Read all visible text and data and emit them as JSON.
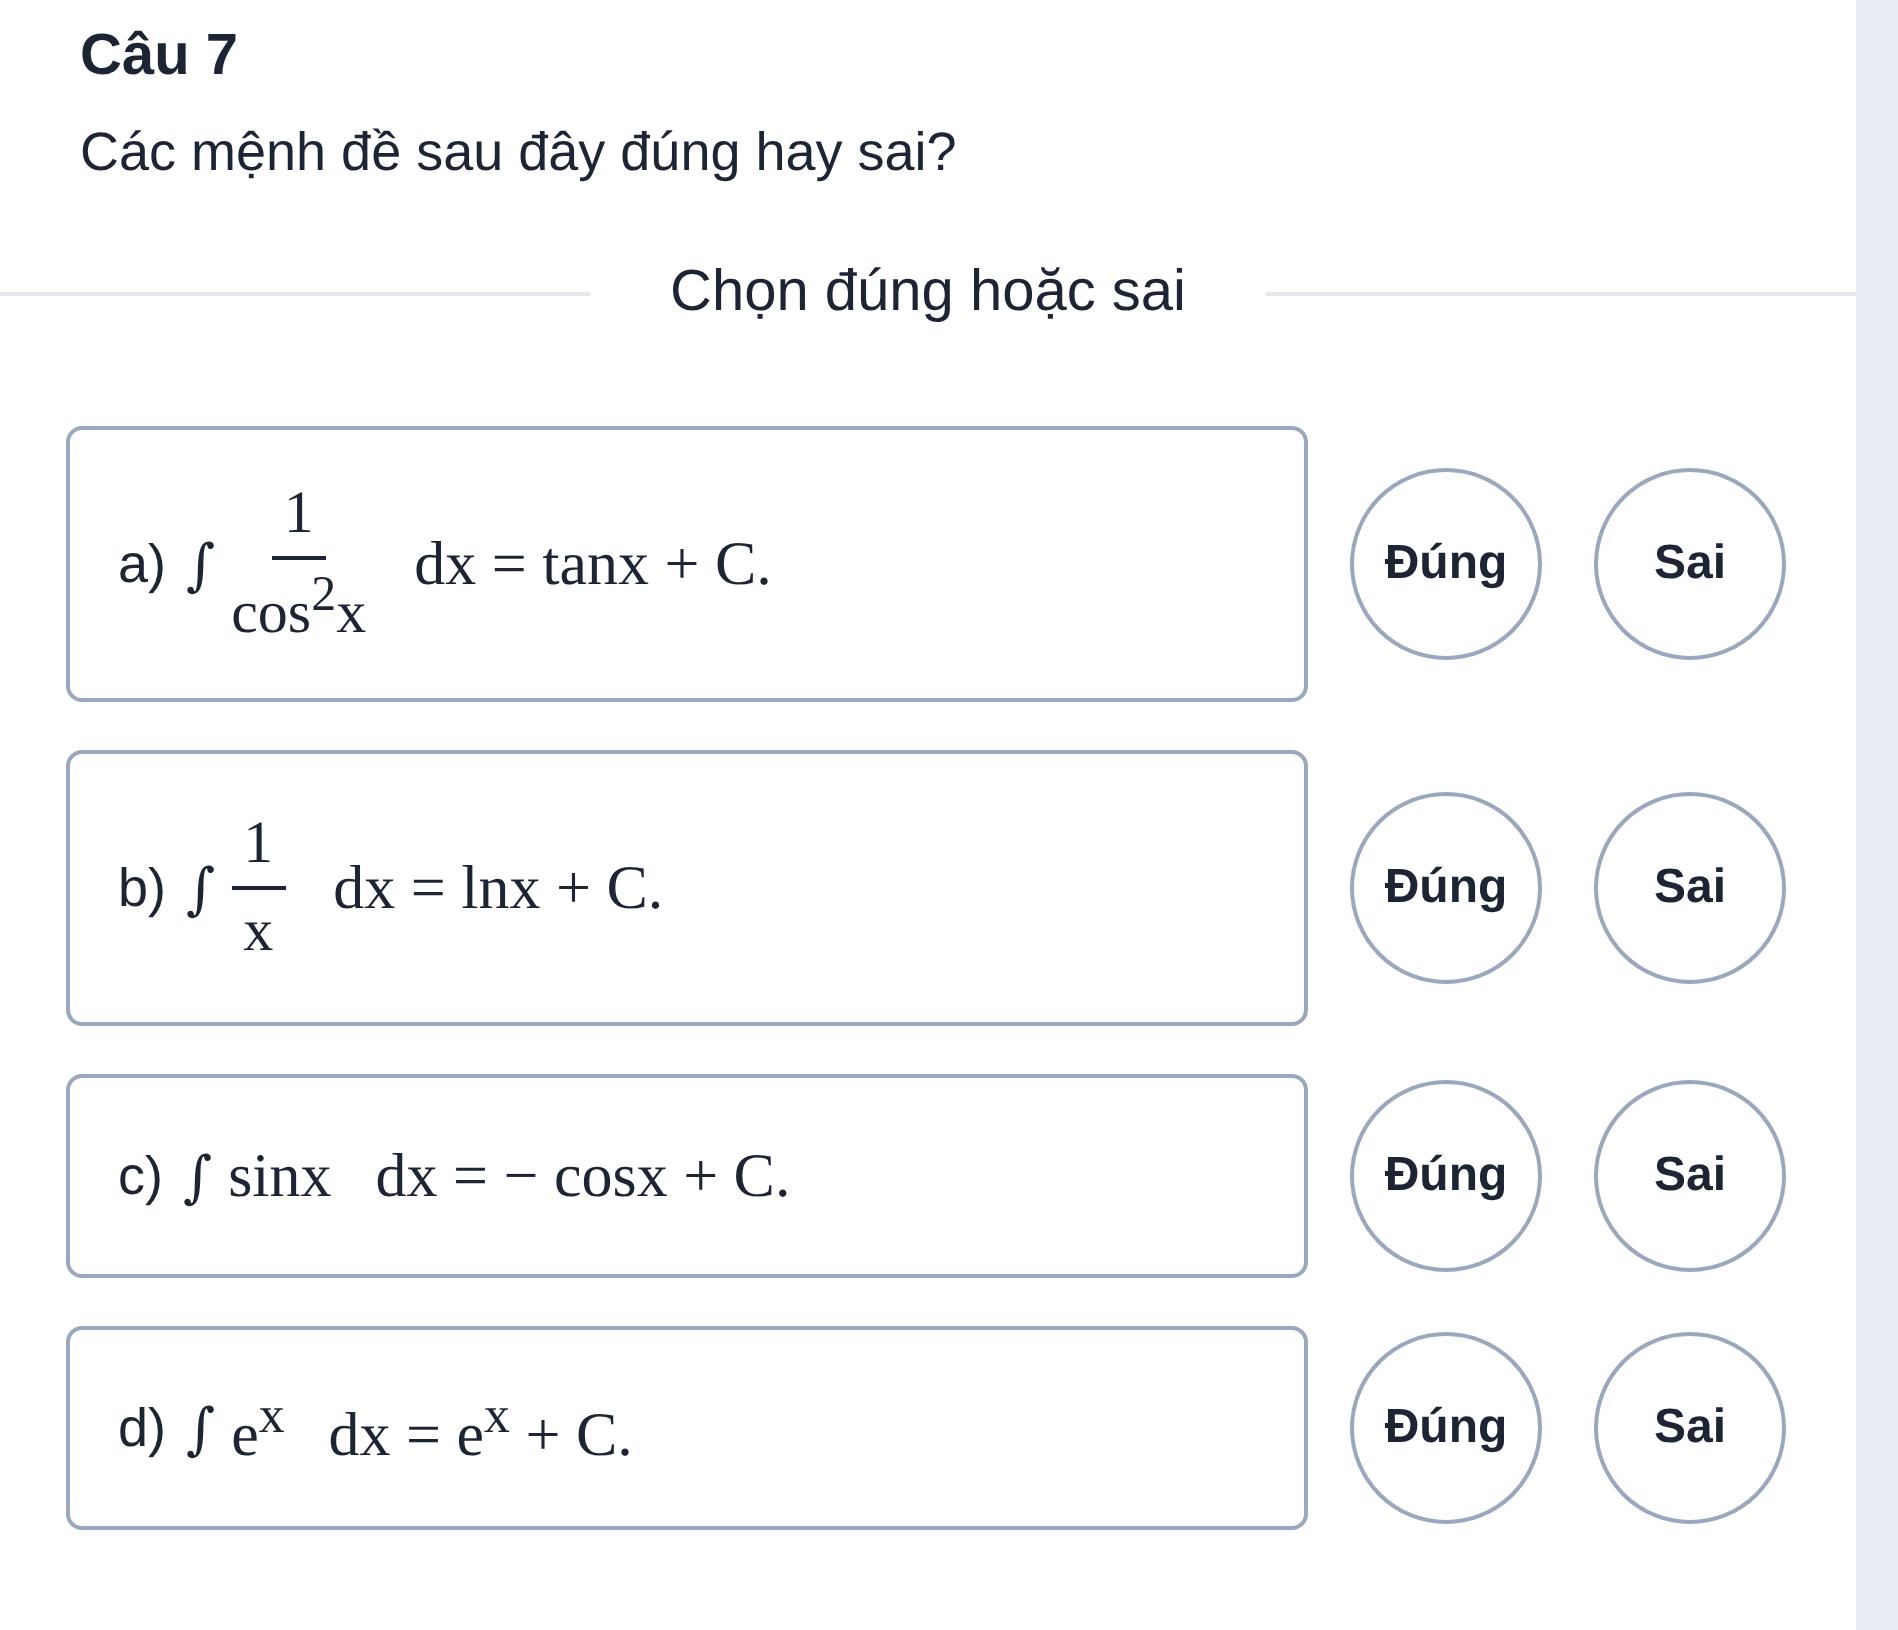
{
  "title": "Câu 7",
  "question": "Các mệnh đề sau đây đúng hay sai?",
  "divider_label": "Chọn đúng hoặc sai",
  "statements": [
    {
      "label": "a)",
      "integral": "∫",
      "kind": "fraction",
      "numerator": "1",
      "denominator": "cos$^{2}$x",
      "rest": "dx = tanx + C.",
      "options": [
        {
          "label": "Đúng",
          "selected": false
        },
        {
          "label": "Sai",
          "selected": false
        }
      ]
    },
    {
      "label": "b)",
      "integral": "∫",
      "kind": "fraction",
      "numerator": "1",
      "denominator": "x",
      "rest": "dx = lnx + C.",
      "options": [
        {
          "label": "Đúng",
          "selected": false
        },
        {
          "label": "Sai",
          "selected": false
        }
      ]
    },
    {
      "label": "c)",
      "integral": "∫",
      "kind": "plain",
      "integrand": "sinx",
      "rest": "dx = − cosx + C.",
      "options": [
        {
          "label": "Đúng",
          "selected": false
        },
        {
          "label": "Sai",
          "selected": false
        }
      ]
    },
    {
      "label": "d)",
      "integral": "∫",
      "kind": "plain",
      "integrand": "e$^{x}$",
      "rest": "dx = e$^{x}$ + C.",
      "options": [
        {
          "label": "Đúng",
          "selected": false
        },
        {
          "label": "Sai",
          "selected": false
        }
      ]
    }
  ]
}
